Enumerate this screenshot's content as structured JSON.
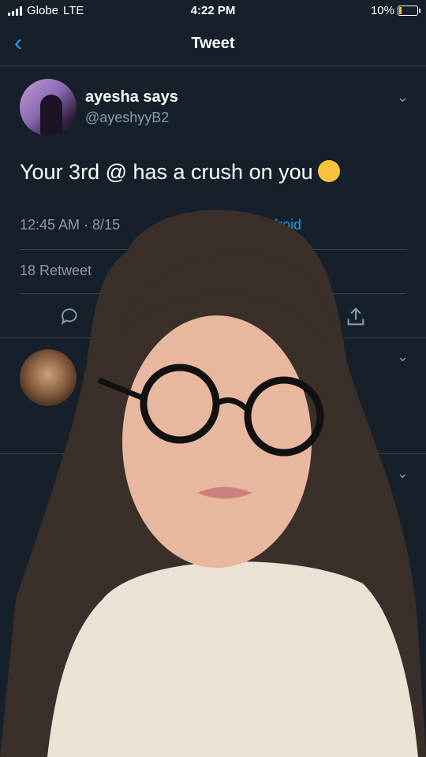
{
  "status_bar": {
    "carrier": "Globe",
    "network": "LTE",
    "time": "4:22 PM",
    "battery": "10%"
  },
  "nav": {
    "back_icon": "chevron-left-icon",
    "title": "Tweet"
  },
  "tweet": {
    "author_name": "ayesha says",
    "author_handle": "@ayeshyyB2",
    "text": "Your 3rd @ has a crush on you",
    "emoji": "winking-face",
    "timestamp": "12:45 AM · 8/15",
    "source": "r Android",
    "retweets_label": "18 Retweet"
  },
  "colors": {
    "background": "#15202b",
    "accent": "#1da1f2",
    "muted": "#8899a6",
    "divider": "#38444d"
  }
}
